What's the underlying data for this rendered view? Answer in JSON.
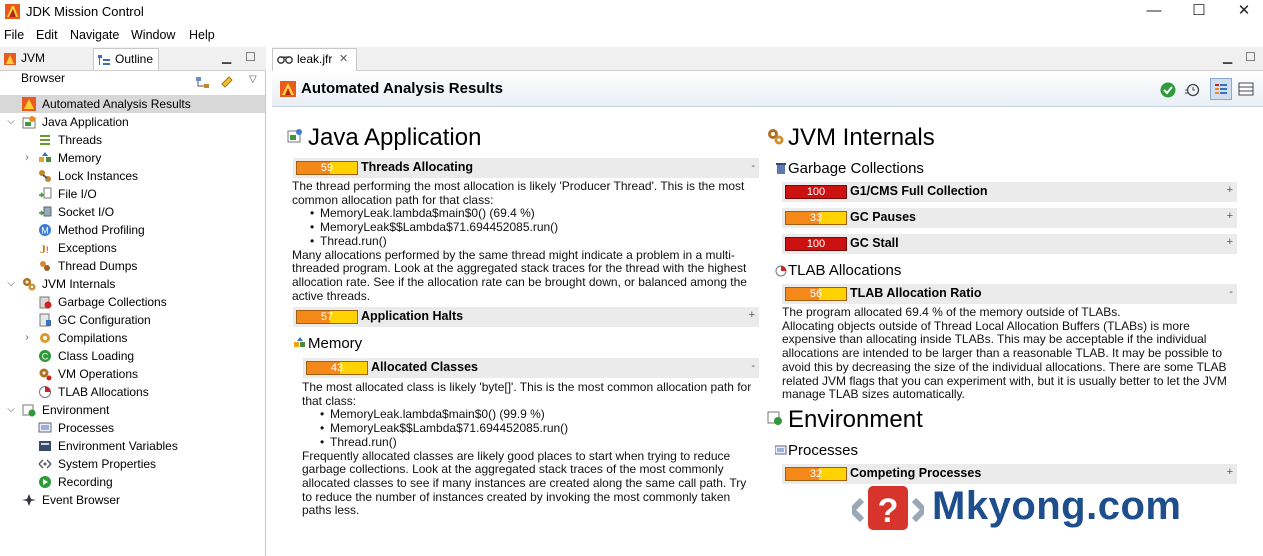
{
  "window": {
    "title": "JDK Mission Control",
    "minimize_glyph": "—",
    "maximize_glyph": "☐",
    "close_glyph": "✕"
  },
  "menu": [
    "File",
    "Edit",
    "Navigate",
    "Window",
    "Help"
  ],
  "left_panel": {
    "tabs": [
      {
        "label": "JVM Browser",
        "icon": "jvm-browser-icon"
      },
      {
        "label": "Outline",
        "icon": "outline-icon",
        "selected": true
      }
    ],
    "tree": [
      {
        "label": "Automated Analysis Results",
        "icon": "analysis-icon",
        "selected": true
      },
      {
        "label": "Java Application",
        "icon": "java-app-icon",
        "expanded": true
      },
      {
        "label": "Threads",
        "icon": "threads-icon"
      },
      {
        "label": "Memory",
        "icon": "memory-icon",
        "collapsed": true
      },
      {
        "label": "Lock Instances",
        "icon": "lock-icon"
      },
      {
        "label": "File I/O",
        "icon": "file-io-icon"
      },
      {
        "label": "Socket I/O",
        "icon": "socket-io-icon"
      },
      {
        "label": "Method Profiling",
        "icon": "method-profiling-icon"
      },
      {
        "label": "Exceptions",
        "icon": "exceptions-icon"
      },
      {
        "label": "Thread Dumps",
        "icon": "thread-dumps-icon"
      },
      {
        "label": "JVM Internals",
        "icon": "jvm-internals-icon",
        "expanded": true
      },
      {
        "label": "Garbage Collections",
        "icon": "gc-icon"
      },
      {
        "label": "GC Configuration",
        "icon": "gc-config-icon"
      },
      {
        "label": "Compilations",
        "icon": "compilations-icon",
        "collapsed": true
      },
      {
        "label": "Class Loading",
        "icon": "class-loading-icon"
      },
      {
        "label": "VM Operations",
        "icon": "vm-operations-icon"
      },
      {
        "label": "TLAB Allocations",
        "icon": "tlab-icon"
      },
      {
        "label": "Environment",
        "icon": "environment-icon",
        "expanded": true
      },
      {
        "label": "Processes",
        "icon": "processes-icon"
      },
      {
        "label": "Environment Variables",
        "icon": "env-vars-icon"
      },
      {
        "label": "System Properties",
        "icon": "system-properties-icon"
      },
      {
        "label": "Recording",
        "icon": "recording-icon"
      },
      {
        "label": "Event Browser",
        "icon": "event-browser-icon"
      }
    ]
  },
  "editor": {
    "tab_label": "leak.jfr",
    "header_title": "Automated Analysis Results",
    "java_application": {
      "title": "Java Application",
      "threads_allocating": {
        "score": "59",
        "name": "Threads Allocating",
        "toggle": "-",
        "text1": "The thread performing the most allocation is likely 'Producer Thread'. This is the most common allocation path for that class:",
        "stack": [
          "MemoryLeak.lambda$main$0() (69.4 %)",
          "MemoryLeak$$Lambda$71.694452085.run()",
          "Thread.run()"
        ],
        "text2": "Many allocations performed by the same thread might indicate a problem in a multi-threaded program. Look at the aggregated stack traces for the thread with the highest allocation rate. See if the allocation rate can be brought down, or balanced among the active threads."
      },
      "application_halts": {
        "score": "57",
        "name": "Application Halts",
        "toggle": "+"
      },
      "memory_title": "Memory",
      "allocated_classes": {
        "score": "43",
        "name": "Allocated Classes",
        "toggle": "-",
        "text1": "The most allocated class is likely 'byte[]'. This is the most common allocation path for that class:",
        "stack": [
          "MemoryLeak.lambda$main$0() (99.9 %)",
          "MemoryLeak$$Lambda$71.694452085.run()",
          "Thread.run()"
        ],
        "text2": "Frequently allocated classes are likely good places to start when trying to reduce garbage collections. Look at the aggregated stack traces of the most commonly allocated classes to see if many instances are created along the same call path. Try to reduce the number of instances created by invoking the most commonly taken paths less."
      }
    },
    "jvm_internals": {
      "title": "JVM Internals",
      "gc_title": "Garbage Collections",
      "gc_rules": [
        {
          "score": "100",
          "name": "G1/CMS Full Collection",
          "toggle": "+",
          "severity": "red"
        },
        {
          "score": "33",
          "name": "GC Pauses",
          "toggle": "+",
          "severity": "orange"
        },
        {
          "score": "100",
          "name": "GC Stall",
          "toggle": "+",
          "severity": "red"
        }
      ],
      "tlab_title": "TLAB Allocations",
      "tlab_rule": {
        "score": "56",
        "name": "TLAB Allocation Ratio",
        "toggle": "-",
        "text1": "The program allocated 69.4 % of the memory outside of TLABs.",
        "text2": "Allocating objects outside of Thread Local Allocation Buffers (TLABs) is more expensive than allocating inside TLABs. This may be acceptable if the individual allocations are intended to be larger than a reasonable TLAB. It may be possible to avoid this by decreasing the size of the individual allocations. There are some TLAB related JVM flags that you can experiment with, but it is usually better to let the JVM manage TLAB sizes automatically."
      }
    },
    "environment": {
      "title": "Environment",
      "processes_title": "Processes",
      "competing_processes": {
        "score": "32",
        "name": "Competing Processes",
        "toggle": "+"
      }
    }
  },
  "watermark": {
    "text": "Mkyong.com",
    "brand_color": "#1e4e8c"
  },
  "colors": {
    "score_orange": "#f4891a",
    "score_yellow": "#ffd200",
    "score_red": "#cc1111"
  }
}
